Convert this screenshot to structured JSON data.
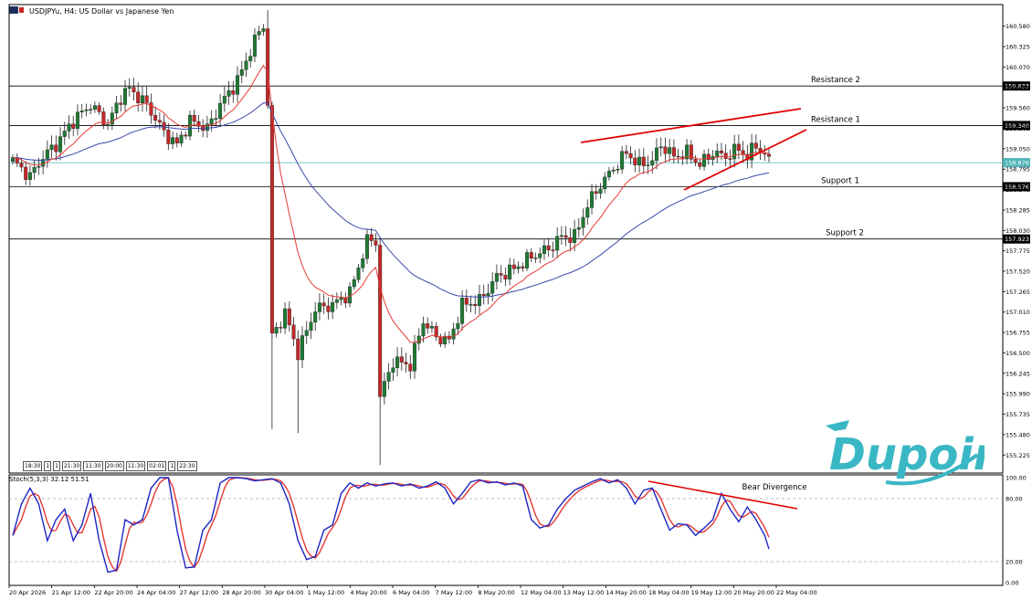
{
  "header": {
    "title": "USDJPYu, H4: US Dollar vs Japanese Yen"
  },
  "indicator": {
    "label": "Stoch(5,3,3) 32.12 51.51"
  },
  "time_boxes": [
    "18:30",
    "1",
    "1",
    "21:30",
    "11:30",
    "20:00",
    "11:30",
    "02:01",
    "1",
    "22:30"
  ],
  "brand": {
    "logo_text": "Dupoin",
    "color": "#3ab7c4"
  },
  "colors": {
    "bull": "#1e7b34",
    "bear": "#c62828",
    "ma_fast": "#e53935",
    "ma_slow": "#3949ab",
    "stoch_k": "#1c24c4",
    "stoch_d": "#e53935",
    "current_price": "#4fb3b8",
    "trend": "#e00000"
  },
  "chart_data": {
    "type": "candlestick",
    "symbol": "USDJPYu",
    "timeframe": "H4",
    "ylim": [
      155.0,
      160.85
    ],
    "y_ticks": [
      "160.580",
      "160.325",
      "160.070",
      "159.815",
      "159.560",
      "159.305",
      "159.050",
      "158.795",
      "158.540",
      "158.285",
      "158.030",
      "157.775",
      "157.520",
      "157.265",
      "157.010",
      "156.755",
      "156.500",
      "156.245",
      "155.990",
      "155.735",
      "155.480",
      "155.225"
    ],
    "x_ticks": [
      "20 Apr 2026",
      "21 Apr 12:00",
      "22 Apr 20:00",
      "24 Apr 04:00",
      "27 Apr 12:00",
      "28 Apr 20:00",
      "30 Apr 04:00",
      "1 May 12:00",
      "4 May 20:00",
      "6 May 04:00",
      "7 May 12:00",
      "8 May 20:00",
      "12 May 04:00",
      "13 May 12:00",
      "14 May 20:00",
      "18 May 04:00",
      "19 May 12:00",
      "20 May 20:00",
      "22 May 04:00"
    ],
    "levels": [
      {
        "label": "Resistance 2",
        "price": 159.833,
        "tag": "159.833"
      },
      {
        "label": "Resistance 1",
        "price": 159.34,
        "tag": "159.340"
      },
      {
        "label": "Support 1",
        "price": 158.576,
        "tag": "158.576"
      },
      {
        "label": "Support 2",
        "price": 157.923,
        "tag": "157.923"
      }
    ],
    "current_price": {
      "price": 158.876,
      "tag": "158.876"
    },
    "anchors": [
      [
        0,
        158.9
      ],
      [
        4,
        158.7
      ],
      [
        7,
        158.95
      ],
      [
        10,
        159.1
      ],
      [
        14,
        159.4
      ],
      [
        18,
        159.6
      ],
      [
        22,
        159.35
      ],
      [
        25,
        159.7
      ],
      [
        27,
        159.8
      ],
      [
        31,
        159.6
      ],
      [
        35,
        159.25
      ],
      [
        38,
        159.1
      ],
      [
        41,
        159.4
      ],
      [
        45,
        159.3
      ],
      [
        48,
        159.6
      ],
      [
        52,
        159.9
      ],
      [
        56,
        160.4
      ],
      [
        58,
        160.6
      ],
      [
        59,
        159.6
      ],
      [
        60,
        156.7
      ],
      [
        63,
        157.0
      ],
      [
        66,
        156.5
      ],
      [
        70,
        157.05
      ],
      [
        74,
        157.1
      ],
      [
        78,
        157.25
      ],
      [
        82,
        157.9
      ],
      [
        84,
        157.9
      ],
      [
        85,
        155.95
      ],
      [
        88,
        156.4
      ],
      [
        92,
        156.35
      ],
      [
        95,
        156.9
      ],
      [
        98,
        156.7
      ],
      [
        101,
        156.65
      ],
      [
        104,
        157.1
      ],
      [
        108,
        157.15
      ],
      [
        112,
        157.45
      ],
      [
        116,
        157.55
      ],
      [
        120,
        157.7
      ],
      [
        124,
        157.8
      ],
      [
        127,
        157.95
      ],
      [
        130,
        157.95
      ],
      [
        133,
        158.35
      ],
      [
        136,
        158.6
      ],
      [
        139,
        158.8
      ],
      [
        142,
        159.0
      ],
      [
        145,
        158.85
      ],
      [
        148,
        158.9
      ],
      [
        150,
        159.1
      ],
      [
        153,
        158.95
      ],
      [
        156,
        159.0
      ],
      [
        159,
        158.85
      ],
      [
        162,
        159.0
      ],
      [
        165,
        158.95
      ],
      [
        168,
        159.05
      ],
      [
        170,
        158.95
      ],
      [
        172,
        159.1
      ],
      [
        175,
        158.9
      ]
    ],
    "stoch_anchors": [
      [
        0,
        45
      ],
      [
        2,
        75
      ],
      [
        4,
        90
      ],
      [
        6,
        75
      ],
      [
        8,
        40
      ],
      [
        10,
        60
      ],
      [
        12,
        70
      ],
      [
        14,
        40
      ],
      [
        16,
        55
      ],
      [
        18,
        85
      ],
      [
        20,
        40
      ],
      [
        22,
        10
      ],
      [
        24,
        12
      ],
      [
        26,
        60
      ],
      [
        28,
        55
      ],
      [
        30,
        60
      ],
      [
        32,
        90
      ],
      [
        34,
        100
      ],
      [
        36,
        100
      ],
      [
        38,
        50
      ],
      [
        40,
        14
      ],
      [
        42,
        15
      ],
      [
        44,
        50
      ],
      [
        46,
        60
      ],
      [
        48,
        95
      ],
      [
        50,
        100
      ],
      [
        52,
        100
      ],
      [
        54,
        99
      ],
      [
        56,
        97
      ],
      [
        58,
        98
      ],
      [
        60,
        99
      ],
      [
        62,
        95
      ],
      [
        64,
        75
      ],
      [
        66,
        40
      ],
      [
        68,
        22
      ],
      [
        70,
        25
      ],
      [
        72,
        50
      ],
      [
        74,
        55
      ],
      [
        76,
        85
      ],
      [
        78,
        95
      ],
      [
        80,
        90
      ],
      [
        82,
        95
      ],
      [
        84,
        92
      ],
      [
        86,
        94
      ],
      [
        88,
        95
      ],
      [
        90,
        92
      ],
      [
        92,
        94
      ],
      [
        94,
        90
      ],
      [
        96,
        92
      ],
      [
        98,
        96
      ],
      [
        100,
        90
      ],
      [
        102,
        75
      ],
      [
        104,
        85
      ],
      [
        106,
        96
      ],
      [
        108,
        98
      ],
      [
        110,
        95
      ],
      [
        112,
        96
      ],
      [
        114,
        93
      ],
      [
        116,
        95
      ],
      [
        118,
        92
      ],
      [
        120,
        60
      ],
      [
        122,
        52
      ],
      [
        124,
        55
      ],
      [
        126,
        70
      ],
      [
        128,
        80
      ],
      [
        130,
        88
      ],
      [
        132,
        92
      ],
      [
        134,
        96
      ],
      [
        136,
        99
      ],
      [
        138,
        95
      ],
      [
        140,
        98
      ],
      [
        142,
        90
      ],
      [
        144,
        75
      ],
      [
        146,
        88
      ],
      [
        148,
        90
      ],
      [
        150,
        70
      ],
      [
        152,
        50
      ],
      [
        154,
        56
      ],
      [
        156,
        55
      ],
      [
        158,
        45
      ],
      [
        160,
        52
      ],
      [
        162,
        60
      ],
      [
        164,
        85
      ],
      [
        166,
        70
      ],
      [
        168,
        58
      ],
      [
        170,
        72
      ],
      [
        172,
        60
      ],
      [
        174,
        45
      ],
      [
        175,
        32
      ]
    ],
    "indicator_levels": [
      {
        "label": "100.00",
        "value": 100
      },
      {
        "label": "80.00",
        "value": 80
      },
      {
        "label": "20.00",
        "value": 20
      },
      {
        "label": "0.00",
        "value": 0
      }
    ],
    "annotations": [
      {
        "text": "Bear Divergence"
      }
    ]
  }
}
